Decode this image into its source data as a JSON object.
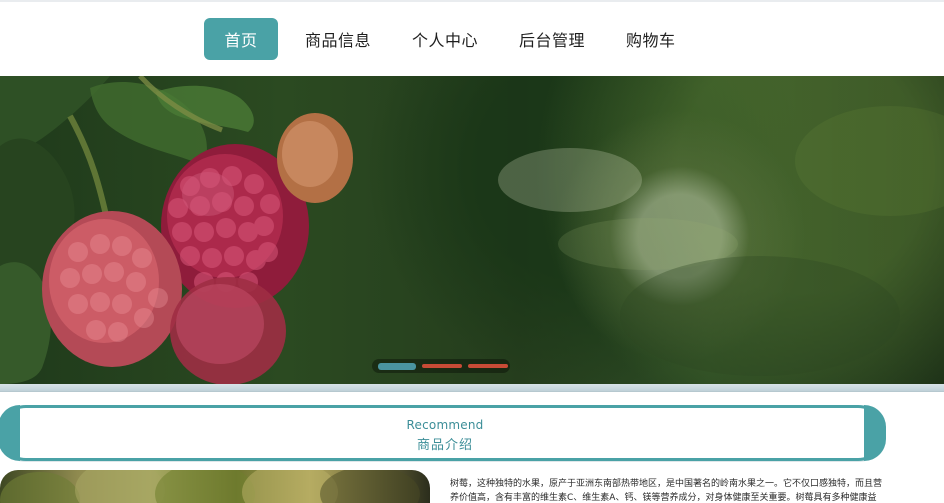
{
  "nav": {
    "items": [
      {
        "label": "首页",
        "active": true
      },
      {
        "label": "商品信息",
        "active": false
      },
      {
        "label": "个人中心",
        "active": false
      },
      {
        "label": "后台管理",
        "active": false
      },
      {
        "label": "购物车",
        "active": false
      }
    ]
  },
  "banner": {
    "carousel": {
      "slide_count": 3,
      "active_index": 0
    }
  },
  "section": {
    "title_en": "Recommend",
    "title_cn": "商品介绍"
  },
  "intro": {
    "text": "树莓，这种独特的水果，原产于亚洲东南部热带地区，是中国著名的岭南水果之一。它不仅口感独特，而且营养价值高，含有丰富的维生素C、维生素A、钙、镁等营养成分，对身体健康至关重要。树莓具有多种健康益处，包括增强免疫力、促进骨骼健康、降低血压、改善心血管健康和促进消化等。它可以直接食用"
  },
  "colors": {
    "accent": "#4aa2a6",
    "accent_text": "#3c8e98",
    "dot_inactive": "#c74b36",
    "dot_active": "#4a94a0"
  }
}
